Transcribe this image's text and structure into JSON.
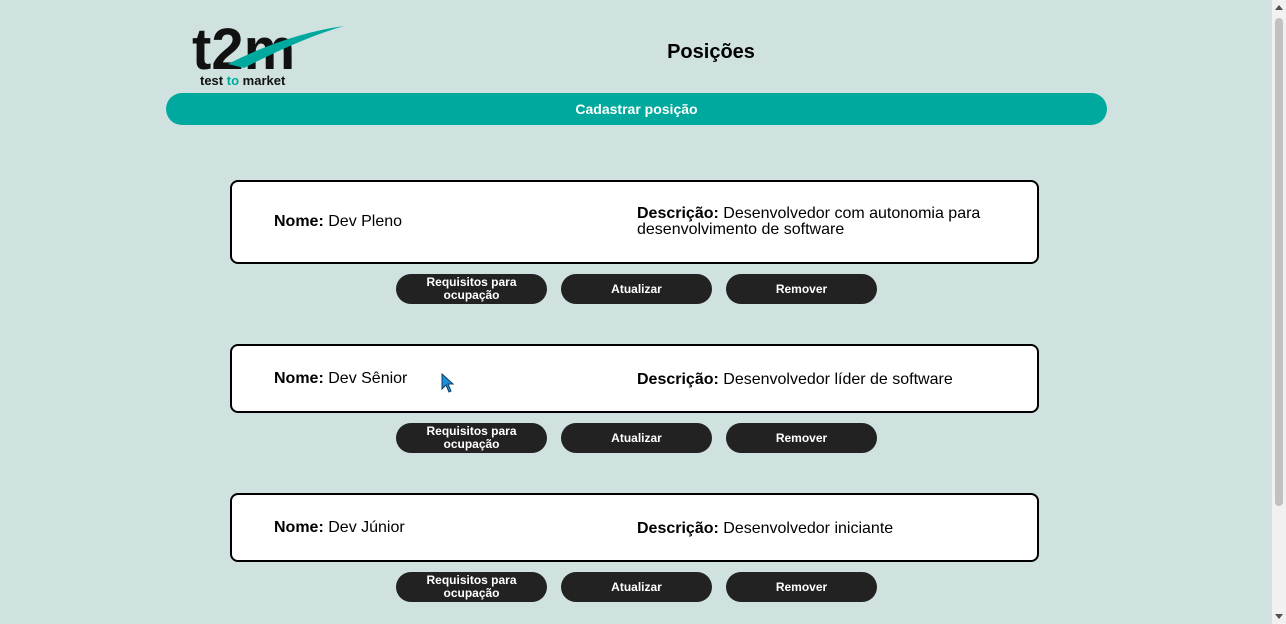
{
  "header": {
    "logo_big": "t2m",
    "logo_sub_1": "test",
    "logo_sub_2": "to",
    "logo_sub_3": "market",
    "title": "Posições"
  },
  "register_button": "Cadastrar posição",
  "labels": {
    "name": "Nome:",
    "description": "Descrição:"
  },
  "actions": {
    "requirements": "Requisitos para ocupação",
    "update": "Atualizar",
    "remove": "Remover"
  },
  "positions": [
    {
      "name": "Dev Pleno",
      "description": "Desenvolvedor com autonomia para desenvolvimento de software"
    },
    {
      "name": "Dev Sênior",
      "description": "Desenvolvedor líder de software"
    },
    {
      "name": "Dev Júnior",
      "description": "Desenvolvedor iniciante"
    }
  ],
  "colors": {
    "background": "#cfe2e0",
    "accent": "#00a99d",
    "button_dark": "#222222"
  }
}
